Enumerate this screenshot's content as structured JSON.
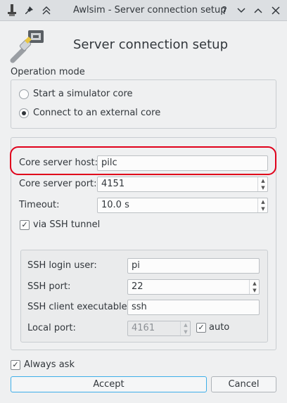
{
  "window": {
    "title": "Awlsim - Server connection setup"
  },
  "header": {
    "title": "Server connection setup"
  },
  "operation_mode": {
    "label": "Operation mode",
    "options": [
      {
        "label": "Start a simulator core",
        "selected": false
      },
      {
        "label": "Connect to an external core",
        "selected": true
      }
    ]
  },
  "server": {
    "host_label": "Core server host:",
    "host_value": "pilc",
    "port_label": "Core server port:",
    "port_value": "4151",
    "timeout_label": "Timeout:",
    "timeout_value": "10.0 s",
    "ssh_tunnel_label": "via SSH tunnel",
    "ssh_tunnel_checked": true
  },
  "ssh": {
    "login_user_label": "SSH login user:",
    "login_user_value": "pi",
    "port_label": "SSH port:",
    "port_value": "22",
    "client_label": "SSH client executable:",
    "client_value": "ssh",
    "local_port_label": "Local port:",
    "local_port_value": "4161",
    "auto_label": "auto",
    "auto_checked": true
  },
  "footer": {
    "always_ask_label": "Always ask",
    "always_ask_checked": true,
    "accept_label": "Accept",
    "cancel_label": "Cancel"
  },
  "colors": {
    "highlight": "#e0001b",
    "default_button_border": "#3daee9"
  }
}
